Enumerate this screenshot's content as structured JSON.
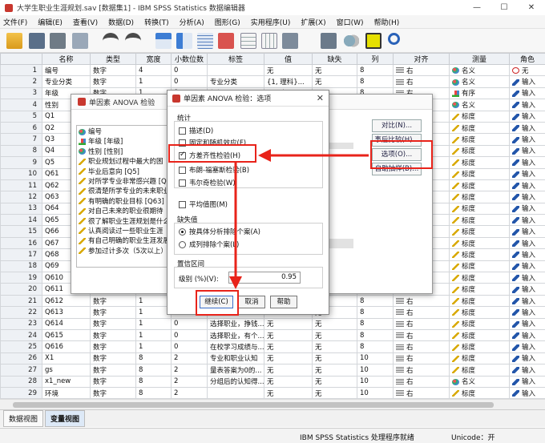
{
  "window": {
    "title": "大学生职业生涯规划.sav [数据集1] - IBM SPSS Statistics 数据编辑器",
    "controls": [
      "—",
      "☐",
      "✕"
    ]
  },
  "menu": [
    "文件(F)",
    "编辑(E)",
    "查看(V)",
    "数据(D)",
    "转换(T)",
    "分析(A)",
    "图形(G)",
    "实用程序(U)",
    "扩展(X)",
    "窗口(W)",
    "帮助(H)"
  ],
  "toolbar_icons": [
    "open-icon",
    "save-icon",
    "print-icon",
    "dialog-recall-icon",
    "undo-icon",
    "redo-icon",
    "goto-case-icon",
    "goto-variable-icon",
    "variables-icon",
    "find-icon",
    "insert-cases-icon",
    "insert-variable-icon",
    "split-file-icon",
    "weight-cases-icon",
    "select-cases-icon",
    "value-labels-icon",
    "search-icon"
  ],
  "columns": [
    "名称",
    "类型",
    "宽度",
    "小数位数",
    "标签",
    "值",
    "缺失",
    "列",
    "对齐",
    "测量",
    "角色"
  ],
  "rows": [
    {
      "n": "1",
      "name": "编号",
      "type": "数字",
      "width": "4",
      "dec": "0",
      "label": "",
      "values": "无",
      "missing": "无",
      "col": "8",
      "align": "右",
      "measure": "名义",
      "mic": "nom",
      "role": "无",
      "ric": "none"
    },
    {
      "n": "2",
      "name": "专业分类",
      "type": "数字",
      "width": "1",
      "dec": "0",
      "label": "专业分类",
      "values": "{1, 理科}...",
      "missing": "无",
      "col": "8",
      "align": "右",
      "measure": "名义",
      "mic": "nom",
      "role": "输入",
      "ric": "in"
    },
    {
      "n": "3",
      "name": "年级",
      "type": "数字",
      "width": "1",
      "dec": "0",
      "label": "年级",
      "values": "{1, 大一}...",
      "missing": "无",
      "col": "8",
      "align": "右",
      "measure": "有序",
      "mic": "ord",
      "role": "输入",
      "ric": "in"
    },
    {
      "n": "4",
      "name": "性别",
      "type": "数字",
      "width": "1",
      "dec": "0",
      "label": "性别",
      "values": "{1, 男}...",
      "missing": "无",
      "col": "8",
      "align": "右",
      "measure": "名义",
      "mic": "nom",
      "role": "输入",
      "ric": "in"
    },
    {
      "n": "5",
      "name": "Q1",
      "type": "数字",
      "width": "1",
      "dec": "0",
      "label": "",
      "values": "",
      "missing": "无",
      "col": "8",
      "align": "右",
      "measure": "标度",
      "mic": "scale",
      "role": "输入",
      "ric": "in"
    },
    {
      "n": "6",
      "name": "Q2",
      "type": "数字",
      "width": "1",
      "dec": "0",
      "label": "",
      "values": "",
      "missing": "无",
      "col": "8",
      "align": "右",
      "measure": "标度",
      "mic": "scale",
      "role": "输入",
      "ric": "in"
    },
    {
      "n": "7",
      "name": "Q3",
      "type": "数字",
      "width": "1",
      "dec": "0",
      "label": "",
      "values": "",
      "missing": "无",
      "col": "8",
      "align": "右",
      "measure": "标度",
      "mic": "scale",
      "role": "输入",
      "ric": "in"
    },
    {
      "n": "8",
      "name": "Q4",
      "type": "数字",
      "width": "1",
      "dec": "0",
      "label": "",
      "values": "",
      "missing": "无",
      "col": "8",
      "align": "右",
      "measure": "标度",
      "mic": "scale",
      "role": "输入",
      "ric": "in"
    },
    {
      "n": "9",
      "name": "Q5",
      "type": "数字",
      "width": "1",
      "dec": "0",
      "label": "",
      "values": "",
      "missing": "无",
      "col": "8",
      "align": "右",
      "measure": "标度",
      "mic": "scale",
      "role": "输入",
      "ric": "in"
    },
    {
      "n": "10",
      "name": "Q61",
      "type": "数字",
      "width": "1",
      "dec": "0",
      "label": "",
      "values": "",
      "missing": "无",
      "col": "8",
      "align": "右",
      "measure": "标度",
      "mic": "scale",
      "role": "输入",
      "ric": "in"
    },
    {
      "n": "11",
      "name": "Q62",
      "type": "数字",
      "width": "1",
      "dec": "0",
      "label": "",
      "values": "",
      "missing": "无",
      "col": "8",
      "align": "右",
      "measure": "标度",
      "mic": "scale",
      "role": "输入",
      "ric": "in"
    },
    {
      "n": "12",
      "name": "Q63",
      "type": "数字",
      "width": "1",
      "dec": "0",
      "label": "",
      "values": "",
      "missing": "无",
      "col": "8",
      "align": "右",
      "measure": "标度",
      "mic": "scale",
      "role": "输入",
      "ric": "in"
    },
    {
      "n": "13",
      "name": "Q64",
      "type": "数字",
      "width": "1",
      "dec": "0",
      "label": "",
      "values": "",
      "missing": "无",
      "col": "8",
      "align": "右",
      "measure": "标度",
      "mic": "scale",
      "role": "输入",
      "ric": "in"
    },
    {
      "n": "14",
      "name": "Q65",
      "type": "数字",
      "width": "1",
      "dec": "0",
      "label": "",
      "values": "",
      "missing": "无",
      "col": "8",
      "align": "右",
      "measure": "标度",
      "mic": "scale",
      "role": "输入",
      "ric": "in"
    },
    {
      "n": "15",
      "name": "Q66",
      "type": "数字",
      "width": "1",
      "dec": "0",
      "label": "",
      "values": "",
      "missing": "无",
      "col": "8",
      "align": "右",
      "measure": "标度",
      "mic": "scale",
      "role": "输入",
      "ric": "in"
    },
    {
      "n": "16",
      "name": "Q67",
      "type": "数字",
      "width": "1",
      "dec": "0",
      "label": "",
      "values": "",
      "missing": "无",
      "col": "8",
      "align": "右",
      "measure": "标度",
      "mic": "scale",
      "role": "输入",
      "ric": "in"
    },
    {
      "n": "17",
      "name": "Q68",
      "type": "数字",
      "width": "1",
      "dec": "0",
      "label": "",
      "values": "",
      "missing": "无",
      "col": "8",
      "align": "右",
      "measure": "标度",
      "mic": "scale",
      "role": "输入",
      "ric": "in"
    },
    {
      "n": "18",
      "name": "Q69",
      "type": "数字",
      "width": "1",
      "dec": "0",
      "label": "",
      "values": "",
      "missing": "无",
      "col": "8",
      "align": "右",
      "measure": "标度",
      "mic": "scale",
      "role": "输入",
      "ric": "in"
    },
    {
      "n": "19",
      "name": "Q610",
      "type": "数字",
      "width": "1",
      "dec": "0",
      "label": "",
      "values": "",
      "missing": "无",
      "col": "8",
      "align": "右",
      "measure": "标度",
      "mic": "scale",
      "role": "输入",
      "ric": "in"
    },
    {
      "n": "20",
      "name": "Q611",
      "type": "数字",
      "width": "1",
      "dec": "0",
      "label": "",
      "values": "",
      "missing": "无",
      "col": "8",
      "align": "右",
      "measure": "标度",
      "mic": "scale",
      "role": "输入",
      "ric": "in"
    },
    {
      "n": "21",
      "name": "Q612",
      "type": "数字",
      "width": "1",
      "dec": "0",
      "label": "",
      "values": "",
      "missing": "无",
      "col": "8",
      "align": "右",
      "measure": "标度",
      "mic": "scale",
      "role": "输入",
      "ric": "in"
    },
    {
      "n": "22",
      "name": "Q613",
      "type": "数字",
      "width": "1",
      "dec": "0",
      "label": "",
      "values": "",
      "missing": "无",
      "col": "8",
      "align": "右",
      "measure": "标度",
      "mic": "scale",
      "role": "输入",
      "ric": "in"
    },
    {
      "n": "23",
      "name": "Q614",
      "type": "数字",
      "width": "1",
      "dec": "0",
      "label": "选择职业，挣钱...",
      "values": "无",
      "missing": "无",
      "col": "8",
      "align": "右",
      "measure": "标度",
      "mic": "scale",
      "role": "输入",
      "ric": "in"
    },
    {
      "n": "24",
      "name": "Q615",
      "type": "数字",
      "width": "1",
      "dec": "0",
      "label": "选择职业，有个...",
      "values": "无",
      "missing": "无",
      "col": "8",
      "align": "右",
      "measure": "标度",
      "mic": "scale",
      "role": "输入",
      "ric": "in"
    },
    {
      "n": "25",
      "name": "Q616",
      "type": "数字",
      "width": "1",
      "dec": "0",
      "label": "在校学习成绩与...",
      "values": "无",
      "missing": "无",
      "col": "8",
      "align": "右",
      "measure": "标度",
      "mic": "scale",
      "role": "输入",
      "ric": "in"
    },
    {
      "n": "26",
      "name": "X1",
      "type": "数字",
      "width": "8",
      "dec": "2",
      "label": "专业和职业认知",
      "values": "无",
      "missing": "无",
      "col": "10",
      "align": "右",
      "measure": "标度",
      "mic": "scale",
      "role": "输入",
      "ric": "in"
    },
    {
      "n": "27",
      "name": "gs",
      "type": "数字",
      "width": "8",
      "dec": "2",
      "label": "量表答案为0的...",
      "values": "无",
      "missing": "无",
      "col": "10",
      "align": "右",
      "measure": "标度",
      "mic": "scale",
      "role": "输入",
      "ric": "in"
    },
    {
      "n": "28",
      "name": "x1_new",
      "type": "数字",
      "width": "8",
      "dec": "2",
      "label": "分组后的认知得...",
      "values": "无",
      "missing": "无",
      "col": "10",
      "align": "右",
      "measure": "名义",
      "mic": "nom",
      "role": "输入",
      "ric": "in"
    },
    {
      "n": "29",
      "name": "环境",
      "type": "数字",
      "width": "8",
      "dec": "2",
      "label": "",
      "values": "无",
      "missing": "无",
      "col": "10",
      "align": "右",
      "measure": "标度",
      "mic": "scale",
      "role": "输入",
      "ric": "in"
    }
  ],
  "tabs": [
    "数据视图",
    "变量视图"
  ],
  "status": {
    "processor": "IBM SPSS Statistics 处理程序就绪",
    "unicode": "Unicode：开"
  },
  "anova_dialog": {
    "title": "单因素 ANOVA 检验",
    "variables": [
      "编号",
      "年级 [年级]",
      "性别 [性别]",
      "职业规划过程中最大的困",
      "毕业后意向 [Q5]",
      "对所学专业非常感兴趣 [Q",
      "很清楚所学专业的未来职业",
      "有明确的职业目标 [Q63]",
      "对自己未来的职业很期待",
      "很了解职业生涯规划是什么",
      "认真阅读过一些职业生涯",
      "有自己明确的职业生涯发展",
      "参加过计多次（5次以上）"
    ],
    "var_icons": [
      "nom",
      "ord",
      "nom",
      "scale",
      "scale",
      "scale",
      "scale",
      "scale",
      "scale",
      "scale",
      "scale",
      "scale",
      "scale"
    ],
    "buttons": [
      "对比(N)...",
      "事后比较(H)...",
      "选项(O)...",
      "自助抽样(B)..."
    ]
  },
  "options_dialog": {
    "title": "单因素 ANOVA 检验：选项",
    "stats_label": "统计",
    "checks": [
      {
        "label": "描述(D)",
        "checked": false
      },
      {
        "label": "固定和随机效应(F)",
        "checked": false
      },
      {
        "label": "方差齐性检验(H)",
        "checked": true
      },
      {
        "label": "布朗-福塞斯检验(B)",
        "checked": false
      },
      {
        "label": "韦尔奇检验(W)",
        "checked": false
      }
    ],
    "means_plot": "平均值图(M)",
    "missing_label": "缺失值",
    "missing_options": [
      {
        "label": "按具体分析排除个案(A)",
        "selected": true
      },
      {
        "label": "成列排除个案(L)",
        "selected": false
      }
    ],
    "conf_label": "置信区间",
    "level_label": "级别 (%)(V):",
    "level_value": "0.95",
    "buttons": {
      "continue": "继续(C)",
      "cancel": "取消",
      "help": "帮助"
    },
    "close": "✕"
  },
  "annotation_color": "#e8231a"
}
